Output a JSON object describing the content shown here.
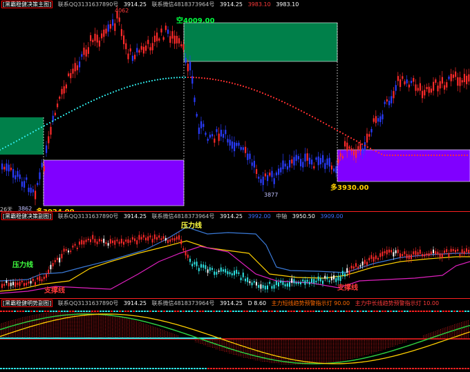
{
  "main_panel": {
    "title": "[黑霸稳健决策主图]",
    "contact_qq": "联系QQ3131637890号",
    "price1": "3914.25",
    "contact_wechat": "联系微信4818373964号",
    "price2": "3914.25",
    "val_red": "3983.10",
    "val_white": "3983.10",
    "high_label": "4062",
    "short_label": "空4009.00",
    "long_label1": "多3924.00",
    "long_label2": "多3930.00",
    "low_label1": "3862",
    "low_label2": "3877",
    "left_note": "26天"
  },
  "mid_panel": {
    "title": "[黑霸稳健决策副图]",
    "contact_qq": "联系QQ3131637890号",
    "price1": "3914.25",
    "contact_wechat": "联系微信4818373964号",
    "price2": "3914.25",
    "val_blue": "3992.00",
    "axis_label": "中轴",
    "axis_val": "3950.50",
    "val_blue2": "3909.00",
    "resistance_top": "压力线",
    "resistance_left": "压力线",
    "support_left": "支撑线",
    "support_right": "支撑线"
  },
  "bottom_panel": {
    "title": "[黑霸稳健明势副图]",
    "contact_qq": "联系QQ3131637890号",
    "price1": "3914.25",
    "contact_wechat": "联系微信4818373964号",
    "price2": "3914.25",
    "d_label": "D 8.60",
    "trend_label": "主力短线趋势预警指示灯 90.00",
    "trend_label2": "主力中长线趋势预警指示灯 10.00"
  },
  "colors": {
    "up": "#ff2a2a",
    "down": "#2a3cff",
    "green_zone": "#00804a",
    "purple_zone": "#8000ff",
    "cyan": "#2ee6e6",
    "yellow": "#ffd000",
    "magenta": "#e020c0",
    "steelblue": "#3a7ad8"
  }
}
